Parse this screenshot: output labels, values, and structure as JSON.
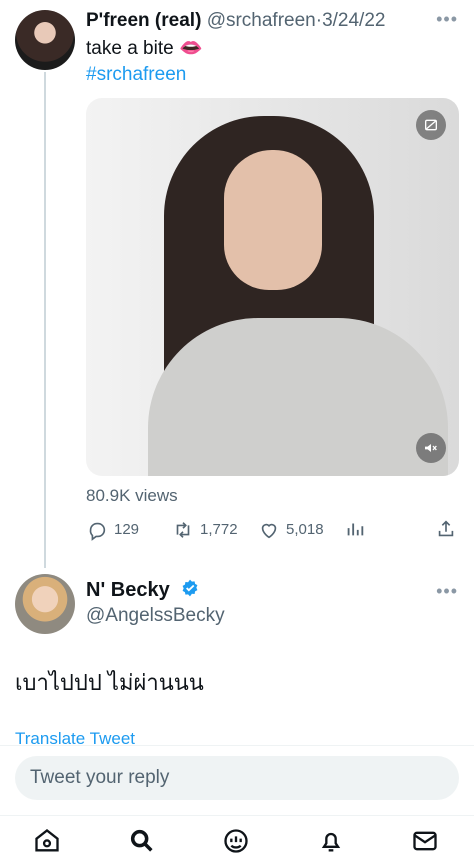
{
  "tweet": {
    "display_name": "P'freen (real)",
    "handle": "@srchafreen",
    "separator": "·",
    "date": "3/24/22",
    "text": "take a bite 👄",
    "hashtag": "#srchafreen",
    "views": "80.9K views",
    "replies": "129",
    "retweets": "1,772",
    "likes": "5,018",
    "more_icon": "ellipsis-icon"
  },
  "reply": {
    "display_name": "N' Becky",
    "handle": "@AngelssBecky",
    "text": "เบาไปปป ไม่ผ่านนน",
    "translate_label": "Translate Tweet",
    "verified_icon": "verified-badge-icon"
  },
  "composer": {
    "placeholder": "Tweet your reply"
  },
  "colors": {
    "accent": "#1d9bf0",
    "secondary_text": "#536471",
    "thread_line": "#cfd9de"
  }
}
